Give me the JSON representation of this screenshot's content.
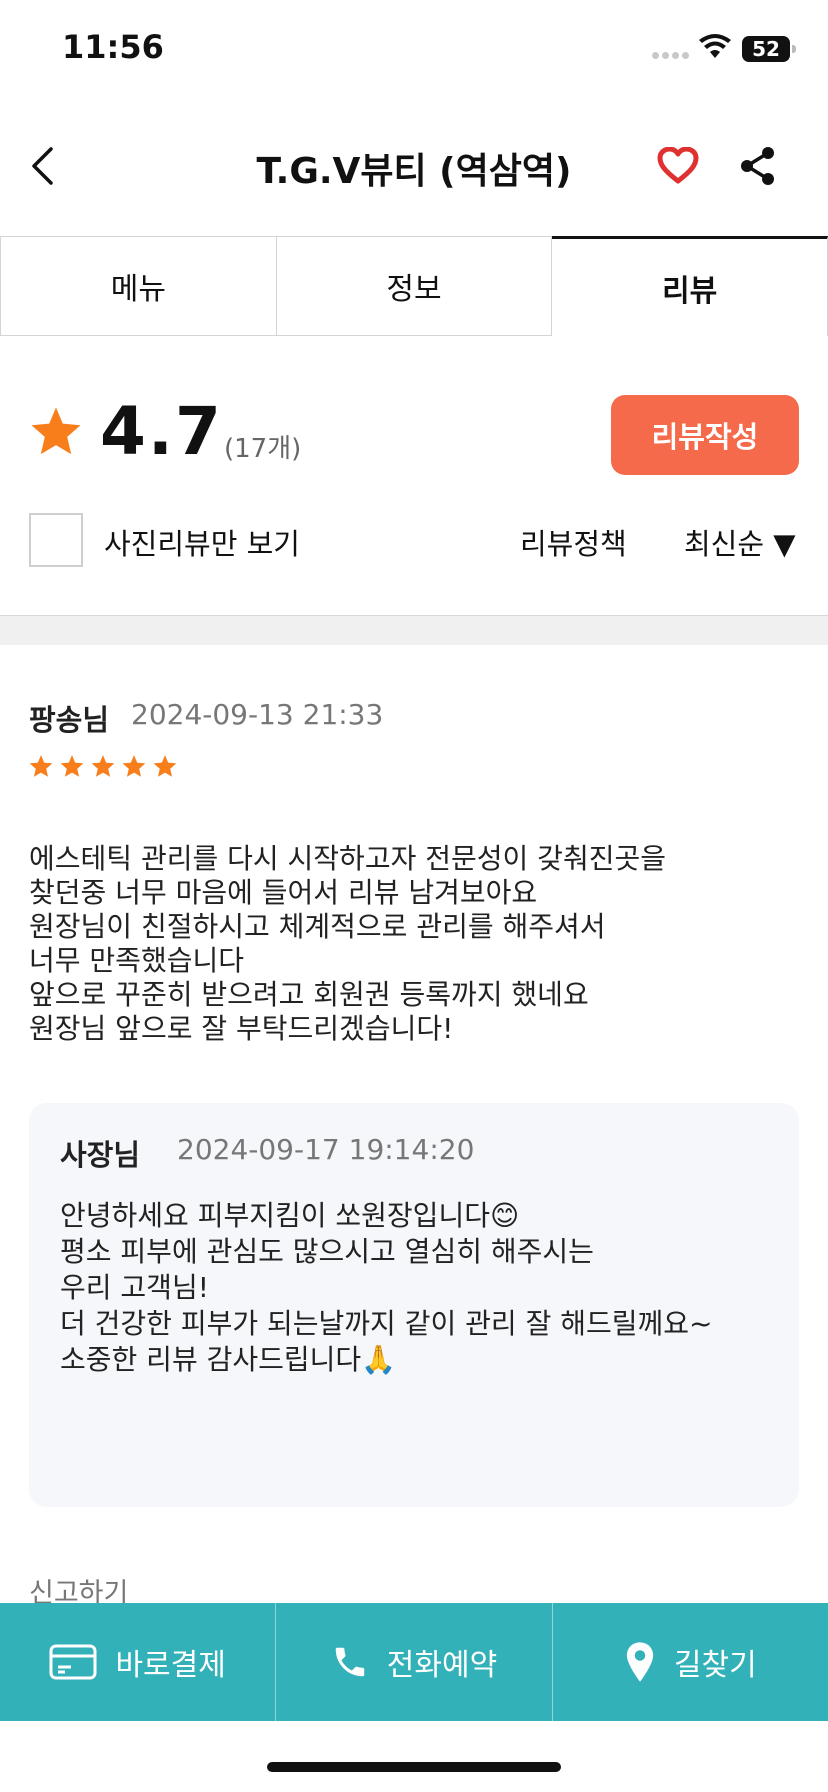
{
  "status_bar": {
    "time": "11:56",
    "battery": "52"
  },
  "header": {
    "title": "T.G.V뷰티 (역삼역)"
  },
  "tabs": [
    {
      "label": "메뉴",
      "active": false
    },
    {
      "label": "정보",
      "active": false
    },
    {
      "label": "리뷰",
      "active": true
    }
  ],
  "summary": {
    "rating": "4.7",
    "count": "(17개)",
    "write_review_label": "리뷰작성",
    "photo_filter_label": "사진리뷰만 보기",
    "photo_filter_checked": false,
    "policy_label": "리뷰정책",
    "sort_label": "최신순 ▼"
  },
  "review": {
    "author": "팡송님",
    "date": "2024-09-13 21:33",
    "stars": 5,
    "body_lines": [
      "에스테틱 관리를 다시 시작하고자 전문성이 갖춰진곳을",
      "찾던중 너무 마음에 들어서 리뷰 남겨보아요",
      "원장님이 친절하시고 체계적으로 관리를 해주셔서",
      "너무 만족했습니다",
      "앞으로 꾸준히 받으려고 회원권 등록까지 했네요",
      "원장님 앞으로 잘 부탁드리겠습니다!"
    ],
    "reply": {
      "author": "사장님",
      "date": "2024-09-17 19:14:20",
      "body_lines": [
        "안녕하세요 피부지킴이 쏘원장입니다😊",
        "평소 피부에 관심도 많으시고 열심히 해주시는",
        "우리 고객님!",
        "더 건강한 피부가 되는날까지 같이 관리 잘 해드릴께요~",
        "소중한 리뷰 감사드립니다🙏"
      ]
    },
    "report_label": "신고하기"
  },
  "bottom_bar": {
    "pay_label": "바로결제",
    "call_label": "전화예약",
    "directions_label": "길찾기"
  },
  "colors": {
    "accent_orange": "#f56a4b",
    "star_orange": "#f77e1a",
    "heart_red": "#e03131",
    "bottom_teal": "#33b1b9"
  },
  "icons": [
    "back-icon",
    "heart-icon",
    "share-icon",
    "star-icon",
    "card-icon",
    "phone-icon",
    "location-pin-icon"
  ]
}
